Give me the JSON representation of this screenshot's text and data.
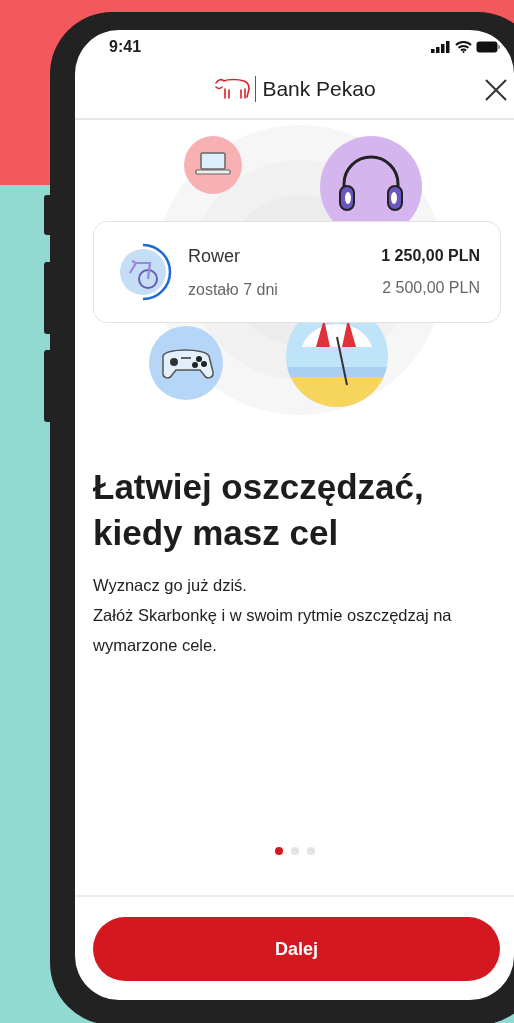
{
  "status_bar": {
    "time": "9:41"
  },
  "header": {
    "brand": "Bank Pekao"
  },
  "goal_card": {
    "name": "Rower",
    "remaining": "zostało 7 dni",
    "saved": "1 250,00 PLN",
    "target": "2 500,00 PLN",
    "level": 0.5
  },
  "headline": "Łatwiej oszczędzać, kiedy masz cel",
  "description": [
    "Wyznacz go już dziś.",
    "Załóż Skarbonkę i w swoim rytmie oszczędzaj na wymarzone cele."
  ],
  "pager": [
    {
      "selected": true
    },
    {
      "selected": false
    },
    {
      "selected": false
    }
  ],
  "primary_button": "Dalej"
}
